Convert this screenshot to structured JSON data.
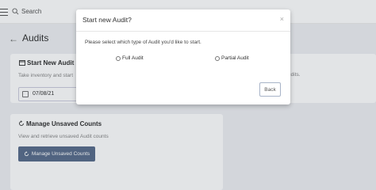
{
  "topbar": {
    "menu_icon": "hamburger-icon",
    "search_icon": "search-icon",
    "search_label": "Search"
  },
  "page": {
    "back_icon": "arrow-left-icon",
    "title": "Audits"
  },
  "cards": {
    "start_new": {
      "icon": "folder-icon",
      "title": "Start New Audit",
      "text": "Take inventory and start",
      "date_icon": "calendar-icon",
      "date_value": "07/08/21"
    },
    "right_card": {
      "text": "c Audits."
    },
    "unsaved": {
      "icon": "refresh-icon",
      "title": "Manage Unsaved Counts",
      "text": "View and retrieve unsaved Audit counts",
      "button_label": "Manage Unsaved Counts",
      "button_icon": "refresh-icon"
    }
  },
  "modal": {
    "title": "Start new Audit?",
    "close_icon": "close-icon",
    "close_glyph": "×",
    "prompt": "Please select which type of Audit you'd like to start.",
    "options": [
      {
        "label": "Full Audit",
        "selected": false
      },
      {
        "label": "Partial Audit",
        "selected": false
      }
    ],
    "back_label": "Back"
  },
  "colors": {
    "primary_button": "#5b6e8c",
    "background": "#eef0f3",
    "back_border": "#a8b4c8"
  }
}
